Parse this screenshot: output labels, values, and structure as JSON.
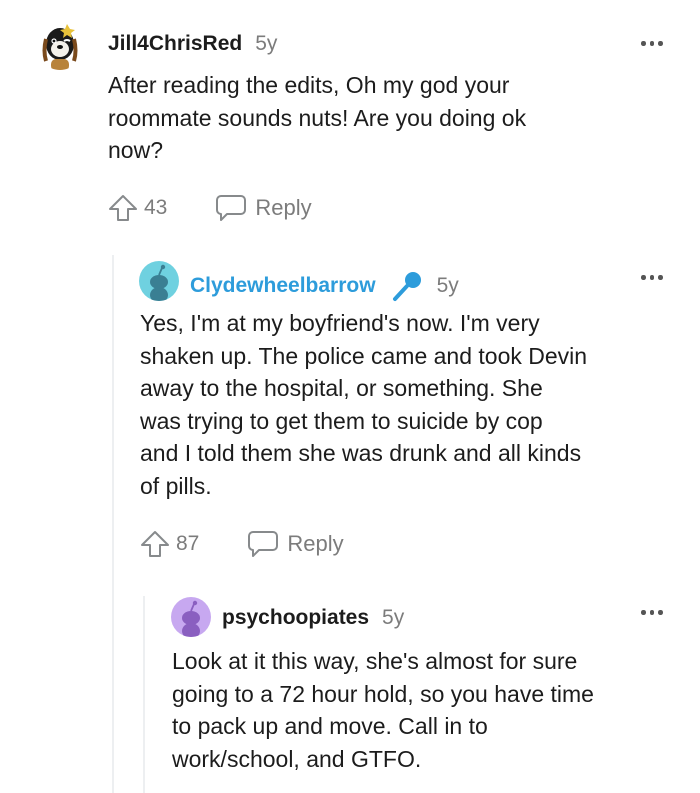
{
  "comments": [
    {
      "username": "Jill4ChrisRed",
      "age": "5y",
      "body_lines": [
        "After reading the edits, Oh my god your",
        "roommate sounds nuts! Are you doing ok",
        "now?"
      ],
      "votes": "43",
      "reply_label": "Reply",
      "avatar_icon": "dog-avatar-icon"
    },
    {
      "username": "Clydewheelbarrow",
      "username_color": "#2d9cdb",
      "is_op": true,
      "op_badge_icon": "microphone-icon",
      "age": "5y",
      "body_lines": [
        "Yes, I'm at my boyfriend's now. I'm very",
        "shaken up. The police came and took Devin",
        "away to the hospital, or something. She",
        "was trying to get them to suicide by cop",
        "and I told them she was drunk and all kinds",
        "of pills."
      ],
      "votes": "87",
      "reply_label": "Reply",
      "avatar_icon": "snoo-avatar-icon",
      "avatar_color": "#6fd1e0"
    },
    {
      "username": "psychoopiates",
      "age": "5y",
      "body_lines": [
        "Look at it this way, she's almost for sure",
        "going to a 72 hour hold, so you have time",
        "to pack up and move. Call in to",
        "work/school, and GTFO."
      ],
      "avatar_icon": "snoo-avatar-icon",
      "avatar_color": "#c7a8f0"
    }
  ],
  "colors": {
    "meta": "#7c7c7c",
    "thread_line": "#edeff1",
    "op": "#2d9cdb"
  }
}
